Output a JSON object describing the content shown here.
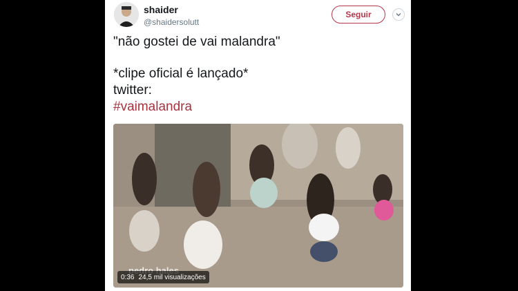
{
  "tweet": {
    "display_name": "shaider",
    "handle": "@shaidersolutt",
    "follow_label": "Seguir",
    "lines": [
      "\"não gostei de vai malandra\"",
      "*clipe oficial é lançado*",
      "twitter:"
    ],
    "hashtag": "#vaimalandra"
  },
  "media": {
    "overlay_text": "pedro hales",
    "duration": "0:36",
    "views": "24,5 mil visualizações"
  },
  "colors": {
    "accent": "#b5364b",
    "hashtag": "#a8323f",
    "background": "#000000"
  },
  "icons": {
    "more": "chevron-down-icon",
    "avatar": "avatar"
  }
}
